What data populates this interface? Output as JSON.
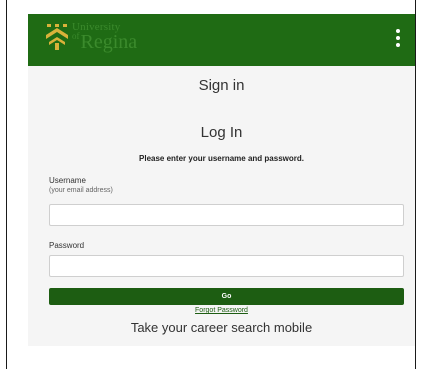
{
  "header": {
    "logo_line1": "University",
    "logo_of": "of",
    "logo_line2": "Regina",
    "menu_icon": "kebab-menu-icon",
    "background_color": "#1f6b14"
  },
  "main": {
    "signin_title": "Sign in",
    "login_title": "Log In",
    "instructions": "Please enter your username and password.",
    "username_label": "Username",
    "username_hint": "(your email address)",
    "username_value": "",
    "password_label": "Password",
    "password_value": "",
    "go_label": "Go",
    "forgot_label": "Forgot Password",
    "career_text": "Take your career search mobile"
  },
  "colors": {
    "accent": "#1d5d12",
    "content_background": "#f5f5f5"
  }
}
